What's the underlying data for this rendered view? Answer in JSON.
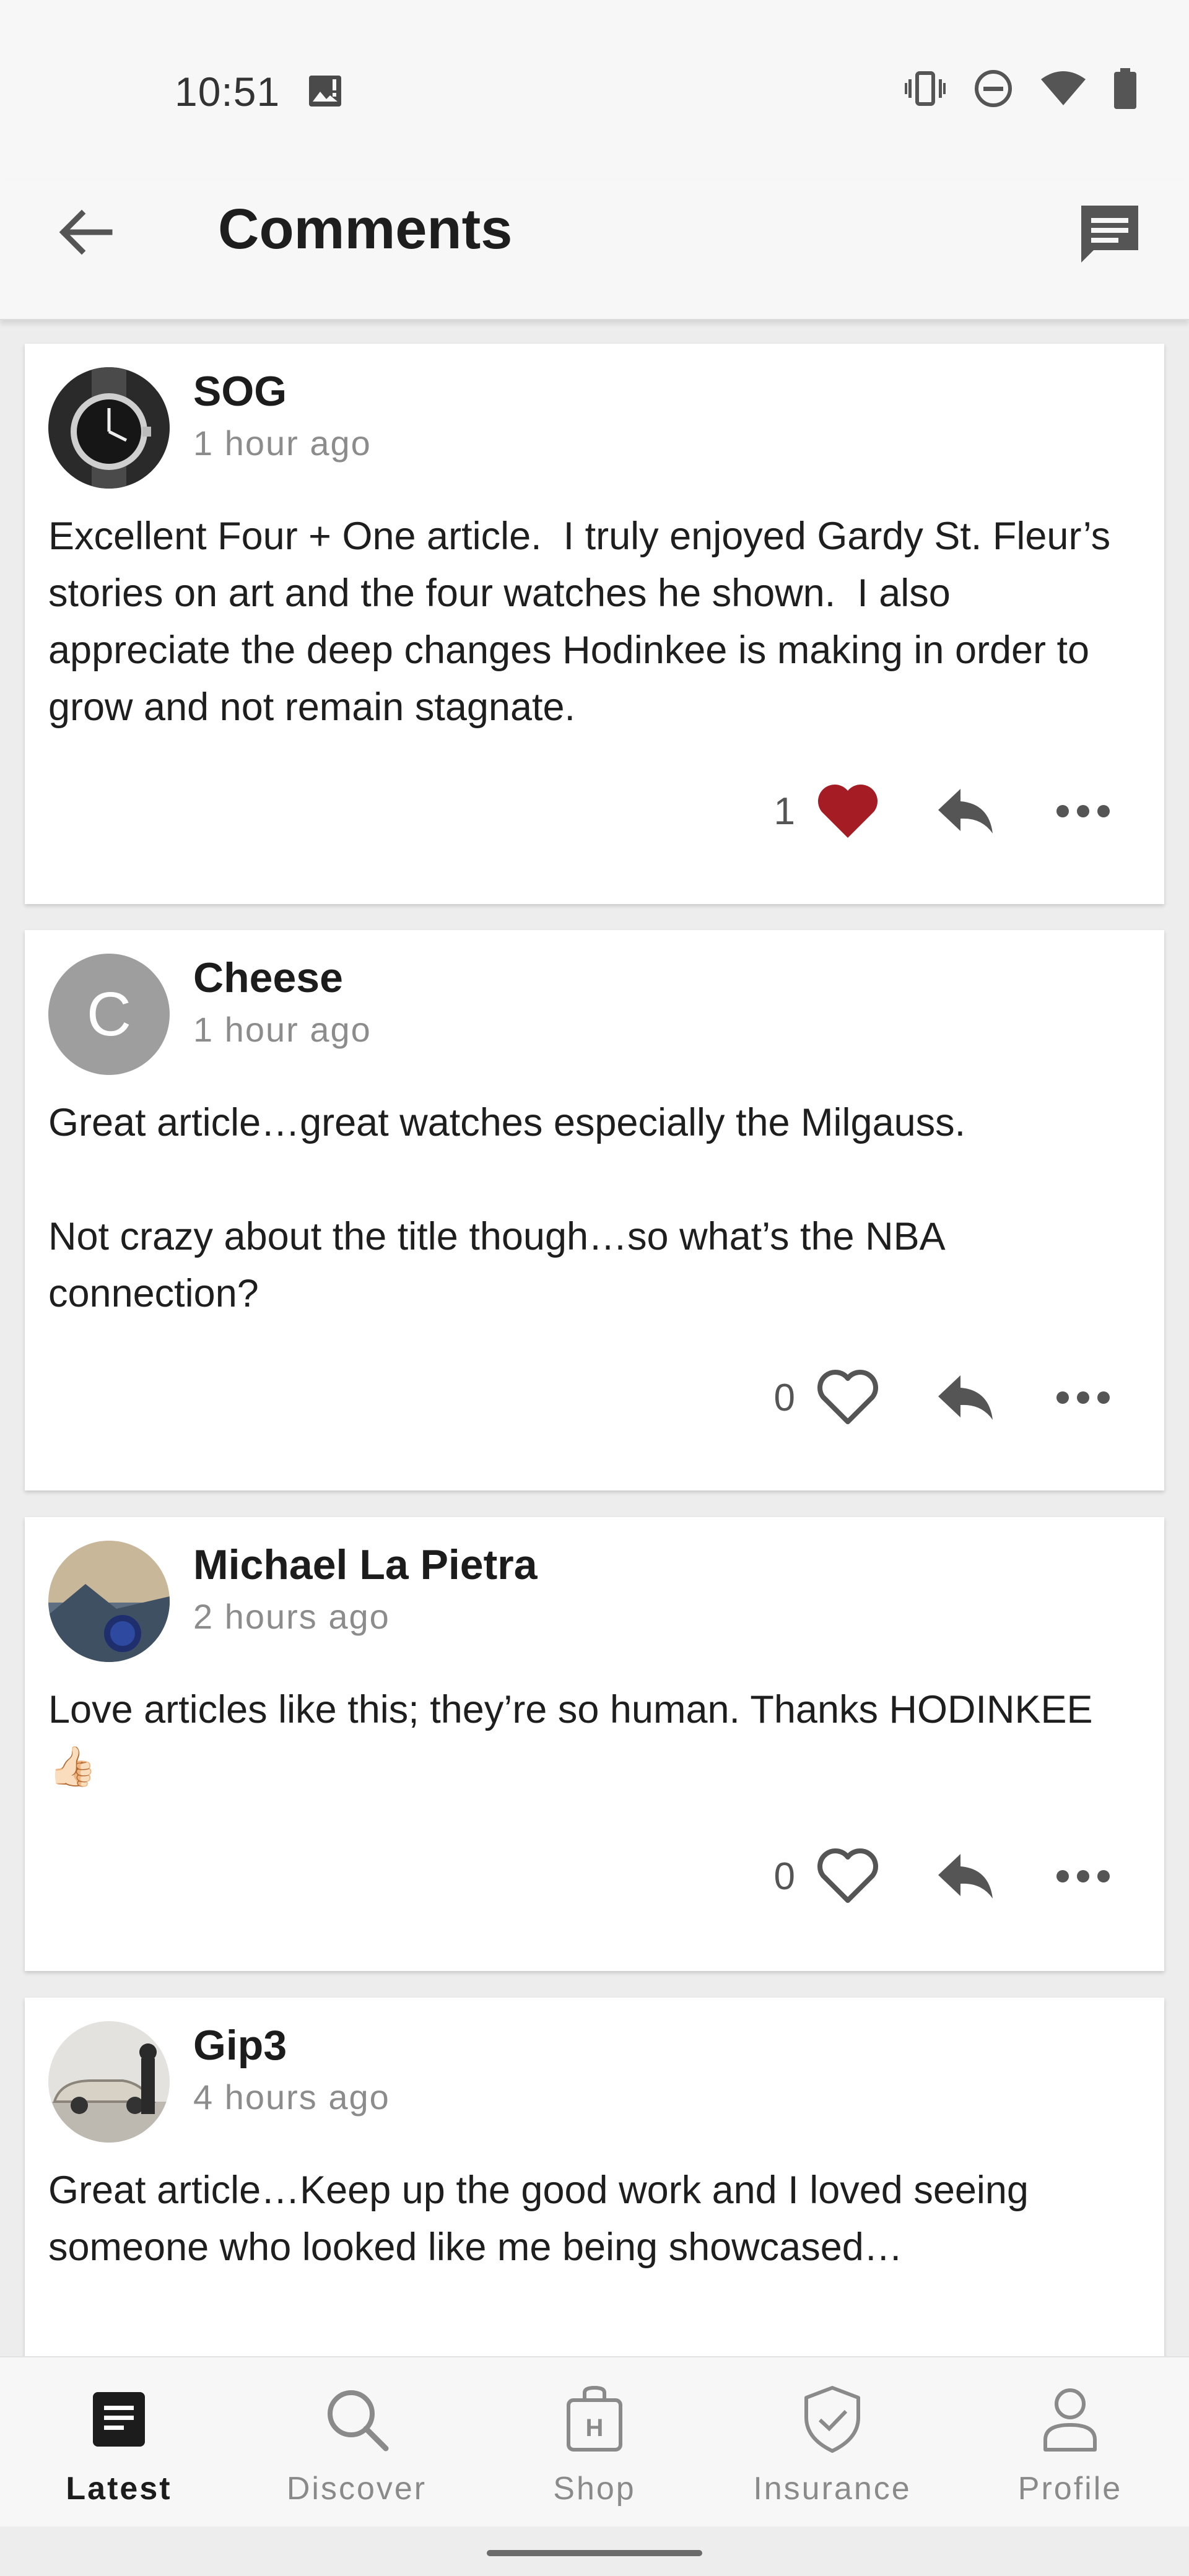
{
  "status_bar": {
    "time": "10:51"
  },
  "app_bar": {
    "title": "Comments"
  },
  "comments": [
    {
      "author": "SOG",
      "time": "1 hour ago",
      "text": "Excellent Four + One article.  I truly enjoyed Gardy St. Fleur’s stories on art and the four watches he shown.  I also appreciate the deep changes Hodinkee is making in order to grow and not remain stagnate.",
      "likes": "1",
      "liked": true
    },
    {
      "author": "Cheese",
      "avatar_initial": "C",
      "time": "1 hour ago",
      "text": "Great article…great watches especially the Milgauss.\n\nNot crazy about the title though…so what’s the NBA connection?",
      "likes": "0",
      "liked": false
    },
    {
      "author": "Michael La Pietra",
      "time": "2 hours ago",
      "text": "Love articles like this; they’re so human. Thanks HODINKEE 👍🏻",
      "likes": "0",
      "liked": false
    },
    {
      "author": "Gip3",
      "time": "4 hours ago",
      "text": "Great article…Keep up the good work and I loved seeing someone who looked like me being showcased…"
    }
  ],
  "bottom_nav": [
    {
      "label": "Latest",
      "icon": "newspaper-icon",
      "active": true
    },
    {
      "label": "Discover",
      "icon": "search-icon"
    },
    {
      "label": "Shop",
      "icon": "shopping-bag-icon"
    },
    {
      "label": "Insurance",
      "icon": "shield-check-icon"
    },
    {
      "label": "Profile",
      "icon": "person-icon"
    }
  ],
  "colors": {
    "liked_heart": "#a51c24",
    "avatar_placeholder": "#9e9e9e",
    "secondary_text": "#8c8c8c"
  }
}
